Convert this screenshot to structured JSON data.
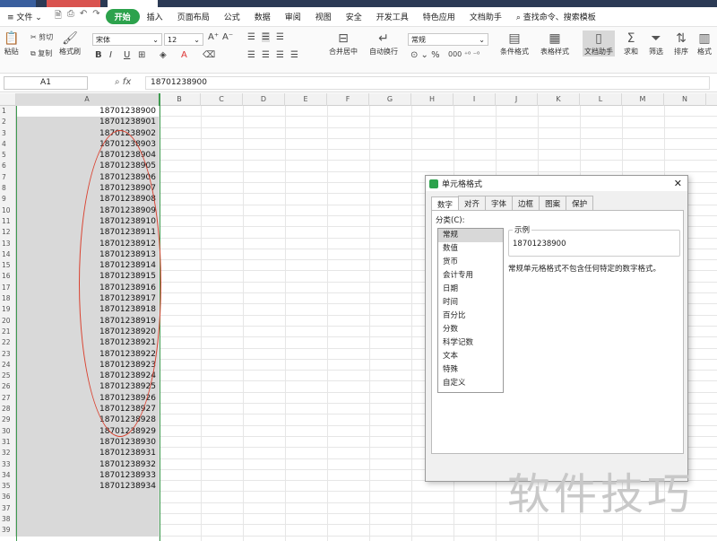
{
  "menubar": {
    "file": "文件",
    "tabs": [
      "开始",
      "插入",
      "页面布局",
      "公式",
      "数据",
      "审阅",
      "视图",
      "安全",
      "开发工具",
      "特色应用",
      "文档助手"
    ],
    "active_tab": "开始",
    "search": "查找命令、搜索模板"
  },
  "ribbon": {
    "cut": "剪切",
    "copy": "复制",
    "paste": "粘贴",
    "format_painter": "格式刷",
    "font_name": "宋体",
    "font_size": "12",
    "merge_center": "合并居中",
    "wrap_text": "自动换行",
    "number_format": "常规",
    "conditional_format": "条件格式",
    "table_style": "表格样式",
    "doc_assistant": "文档助手",
    "sum": "求和",
    "filter": "筛选",
    "sort": "排序",
    "format": "格式"
  },
  "formula_bar": {
    "name_box": "A1",
    "fx": "fx",
    "value": "18701238900"
  },
  "columns": [
    "A",
    "B",
    "C",
    "D",
    "E",
    "F",
    "G",
    "H",
    "I",
    "J",
    "K",
    "L",
    "M",
    "N"
  ],
  "rows": [
    {
      "n": "1",
      "a": "18701238900"
    },
    {
      "n": "2",
      "a": "18701238901"
    },
    {
      "n": "3",
      "a": "18701238902"
    },
    {
      "n": "4",
      "a": "18701238903"
    },
    {
      "n": "5",
      "a": "18701238904"
    },
    {
      "n": "6",
      "a": "18701238905"
    },
    {
      "n": "7",
      "a": "18701238906"
    },
    {
      "n": "8",
      "a": "18701238907"
    },
    {
      "n": "9",
      "a": "18701238908"
    },
    {
      "n": "10",
      "a": "18701238909"
    },
    {
      "n": "11",
      "a": "18701238910"
    },
    {
      "n": "12",
      "a": "18701238911"
    },
    {
      "n": "13",
      "a": "18701238912"
    },
    {
      "n": "14",
      "a": "18701238913"
    },
    {
      "n": "15",
      "a": "18701238914"
    },
    {
      "n": "16",
      "a": "18701238915"
    },
    {
      "n": "17",
      "a": "18701238916"
    },
    {
      "n": "18",
      "a": "18701238917"
    },
    {
      "n": "19",
      "a": "18701238918"
    },
    {
      "n": "20",
      "a": "18701238919"
    },
    {
      "n": "21",
      "a": "18701238920"
    },
    {
      "n": "22",
      "a": "18701238921"
    },
    {
      "n": "23",
      "a": "18701238922"
    },
    {
      "n": "24",
      "a": "18701238923"
    },
    {
      "n": "25",
      "a": "18701238924"
    },
    {
      "n": "26",
      "a": "18701238925"
    },
    {
      "n": "27",
      "a": "18701238926"
    },
    {
      "n": "28",
      "a": "18701238927"
    },
    {
      "n": "29",
      "a": "18701238928"
    },
    {
      "n": "30",
      "a": "18701238929"
    },
    {
      "n": "31",
      "a": "18701238930"
    },
    {
      "n": "32",
      "a": "18701238931"
    },
    {
      "n": "33",
      "a": "18701238932"
    },
    {
      "n": "34",
      "a": "18701238933"
    },
    {
      "n": "35",
      "a": "18701238934"
    },
    {
      "n": "36",
      "a": ""
    },
    {
      "n": "37",
      "a": ""
    },
    {
      "n": "38",
      "a": ""
    },
    {
      "n": "39",
      "a": ""
    }
  ],
  "dialog": {
    "title": "单元格格式",
    "close": "✕",
    "tabs": [
      "数字",
      "对齐",
      "字体",
      "边框",
      "图案",
      "保护"
    ],
    "category_label": "分类(C):",
    "categories": [
      "常规",
      "数值",
      "货币",
      "会计专用",
      "日期",
      "时间",
      "百分比",
      "分数",
      "科学记数",
      "文本",
      "特殊",
      "自定义"
    ],
    "selected_category": "常规",
    "sample_label": "示例",
    "sample_value": "18701238900",
    "description": "常规单元格格式不包含任何特定的数字格式。"
  },
  "watermark": "软件技巧",
  "colors": {
    "accent": "#2ca24c",
    "annotation": "#d9412f",
    "selection_border": "#3d9b4f"
  }
}
